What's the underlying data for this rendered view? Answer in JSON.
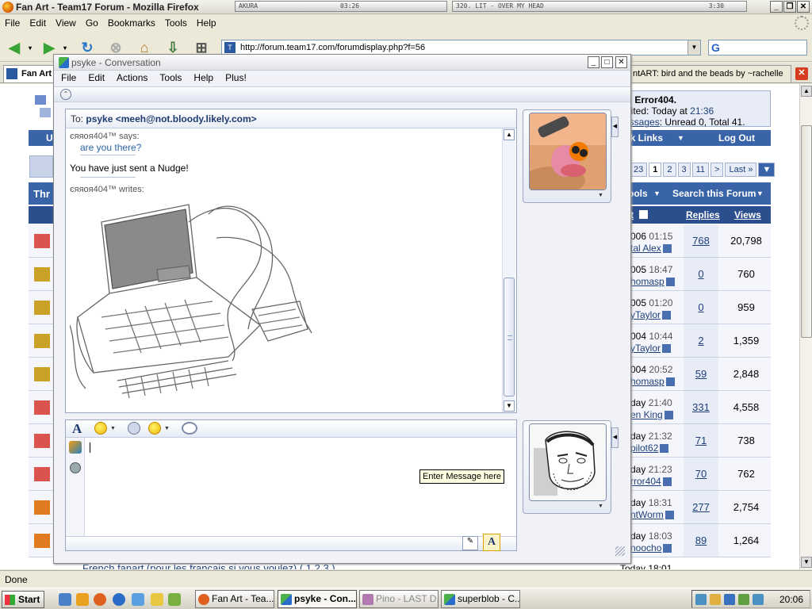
{
  "firefox": {
    "title": "Fan Art - Team17 Forum - Mozilla Firefox",
    "akura": "AKURA",
    "akura_time": "03:26",
    "winamp_track": "320. LIT - OVER MY HEAD",
    "winamp_time": "3:30",
    "menu": [
      "File",
      "Edit",
      "View",
      "Go",
      "Bookmarks",
      "Tools",
      "Help"
    ],
    "url": "http://forum.team17.com/forumdisplay.php?f=56",
    "search_engine": "G",
    "tabs": [
      "Fan Art",
      "ntART: bird and the beads by ~rachelle"
    ],
    "status": "Done"
  },
  "forum": {
    "welcome_line1": "e, Error404.",
    "welcome_line2_prefix": "isited: Today at ",
    "welcome_line2_time": "21:36",
    "welcome_line3_link": "essages",
    "welcome_line3_rest": ": Unread 0, Total 41.",
    "nav_quick_links": "ck Links",
    "nav_logout": "Log Out",
    "nav_partial": "U",
    "pager": [
      "23",
      "1",
      "2",
      "3",
      "11",
      ">",
      "Last »"
    ],
    "tools_left": "Thr",
    "tools_tools": "ools",
    "tools_search": "Search this Forum",
    "col_last": "t",
    "col_replies": "Replies",
    "col_views": "Views",
    "threads": [
      {
        "lp_date": "006",
        "lp_time": "01:15",
        "lp_user": "tal Alex",
        "replies": "768",
        "views": "20,798"
      },
      {
        "lp_date": "005",
        "lp_time": "18:47",
        "lp_user": "homasp",
        "replies": "0",
        "views": "760"
      },
      {
        "lp_date": "005",
        "lp_time": "01:20",
        "lp_user": "yTaylor",
        "replies": "0",
        "views": "959"
      },
      {
        "lp_date": "004",
        "lp_time": "10:44",
        "lp_user": "yTaylor",
        "replies": "2",
        "views": "1,359"
      },
      {
        "lp_date": "004",
        "lp_time": "20:52",
        "lp_user": "homasp",
        "replies": "59",
        "views": "2,848"
      },
      {
        "lp_date": "day",
        "lp_time": "21:40",
        "lp_user": "en King",
        "replies": "331",
        "views": "4,558"
      },
      {
        "lp_date": "day",
        "lp_time": "21:32",
        "lp_user": "pilot62",
        "replies": "71",
        "views": "738"
      },
      {
        "lp_date": "day",
        "lp_time": "21:23",
        "lp_user": "rror404",
        "replies": "70",
        "views": "762"
      },
      {
        "lp_date": "day",
        "lp_time": "18:31",
        "lp_user": "ntWorm",
        "replies": "277",
        "views": "2,754"
      },
      {
        "lp_date": "day",
        "lp_time": "18:03",
        "lp_user": "noocho",
        "replies": "89",
        "views": "1,264"
      }
    ],
    "bottom_thread": "French fanart (pour les français si vous voulez)   (  1 2 3 )",
    "bottom_date": "Today 18:01"
  },
  "conversation": {
    "title": "psyke - Conversation",
    "menu": [
      "File",
      "Edit",
      "Actions",
      "Tools",
      "Help",
      "Plus!"
    ],
    "to_label": "To:",
    "to_name": "psyke <meeh@not.bloody.likely.com>",
    "messages": [
      {
        "header": "єяяoя404™ says:",
        "text": "are you there?"
      },
      {
        "system": "You have just sent a Nudge!"
      },
      {
        "header": "єяяoя404™ writes:"
      }
    ],
    "compose_value": "",
    "tooltip": "Enter Message here"
  },
  "taskbar": {
    "start": "Start",
    "tasks": [
      "Fan Art - Tea...",
      "psyke - Con...",
      "Pino - LAST D...",
      "superblob - C..."
    ],
    "clock": "20:06"
  },
  "colors": {
    "forum_blue": "#3a64a8",
    "forum_dark": "#2b4f8c",
    "msn_link": "#2a64a8"
  }
}
